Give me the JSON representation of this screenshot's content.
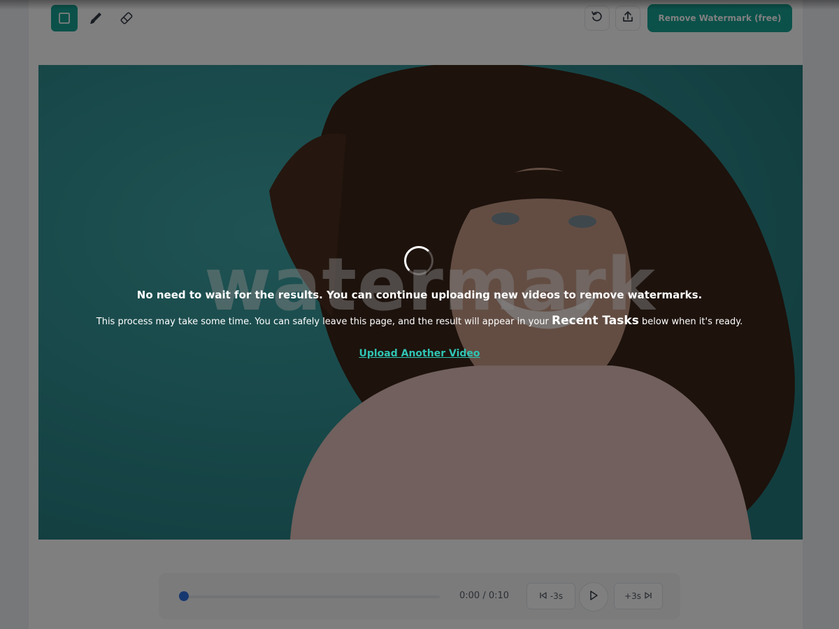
{
  "toolbar": {
    "tools": [
      {
        "icon": "rectangle-select-icon",
        "active": true
      },
      {
        "icon": "brush-icon",
        "active": false
      },
      {
        "icon": "eraser-icon",
        "active": false
      }
    ],
    "undo_icon": "undo-icon",
    "upload_icon": "upload-icon",
    "remove_button_label": "Remove Watermark (free)"
  },
  "video": {
    "watermark_text": "watermark"
  },
  "player": {
    "current_time": "0:00",
    "duration": "0:10",
    "time_separator": "/",
    "progress": 0,
    "back_label": "-3s",
    "forward_label": "+3s"
  },
  "processing": {
    "headline": "No need to wait for the results. You can continue uploading new videos to remove watermarks.",
    "sub_before": "This process may take some time. You can safely leave this page, and the result will appear in your",
    "sub_emphasis": "Recent Tasks",
    "sub_after": "below when it's ready.",
    "upload_link": "Upload Another Video"
  },
  "colors": {
    "accent": "#16a394",
    "link": "#2fc4b4",
    "progress_thumb": "#2f6fe0",
    "video_background": "#2f8f92"
  }
}
